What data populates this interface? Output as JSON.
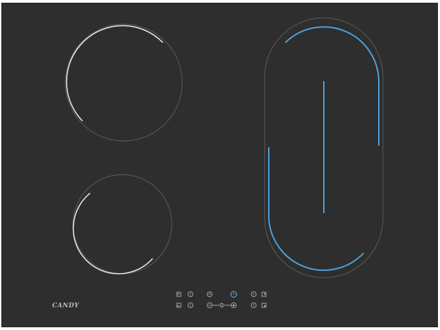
{
  "appliance": {
    "brand_text": "CANDY"
  },
  "colors": {
    "glass": "#2e2e2e",
    "zone_outline": "#555555",
    "zone_active_white": "#e8e8e8",
    "zone_active_blue": "#4aa3df",
    "control_symbol": "#b5b5b5",
    "control_active": "#7fc3ef"
  },
  "cooking_zones": [
    {
      "name": "front-left-zone",
      "state": "on",
      "indicator": "white"
    },
    {
      "name": "rear-left-zone",
      "state": "on",
      "indicator": "white"
    },
    {
      "name": "bridge-zone",
      "state": "on",
      "indicator": "blue"
    }
  ],
  "touch_controls": [
    {
      "name": "zone-select-top-left",
      "icon": "square-icon"
    },
    {
      "name": "timer-top-left",
      "icon": "dot-icon"
    },
    {
      "name": "slider-minus",
      "icon": "minus-icon"
    },
    {
      "name": "power-button",
      "icon": "power-icon"
    },
    {
      "name": "timer-top-right",
      "icon": "dot-icon"
    },
    {
      "name": "zone-select-top-right",
      "icon": "square-icon"
    },
    {
      "name": "zone-select-bottom-left",
      "icon": "square-icon"
    },
    {
      "name": "timer-bottom-left",
      "icon": "dot-icon"
    },
    {
      "name": "slider-bar",
      "icon": "slider-icon"
    },
    {
      "name": "lock-button",
      "icon": "lock-icon"
    },
    {
      "name": "timer-bottom-right",
      "icon": "dot-icon"
    },
    {
      "name": "zone-select-bottom-right",
      "icon": "square-icon"
    }
  ]
}
